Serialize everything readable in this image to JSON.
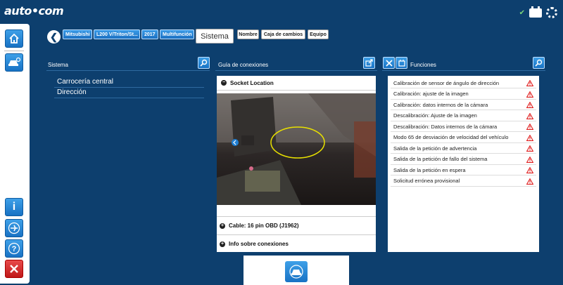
{
  "app": {
    "logo": "auto•com"
  },
  "breadcrumb": [
    "Mitsubishi",
    "L200 V/Triton/St...",
    "2017",
    "Multifunción"
  ],
  "tabs": {
    "active": "Sistema",
    "others": [
      "Nombre",
      "Caja de cambios",
      "Equipo"
    ]
  },
  "sistema": {
    "title": "Sistema",
    "items": [
      "Carrocería central",
      "Dirección"
    ]
  },
  "guia": {
    "title": "Guía de conexiones",
    "socket_label": "Socket Location",
    "cable_label": "Cable: 16 pin OBD (J1962)",
    "info_label": "Info sobre conexiones"
  },
  "funciones": {
    "title": "Funciones",
    "items": [
      "Calibración de sensor de ángulo de dirección",
      "Calibración: ajuste de la imagen",
      "Calibración: datos internos de la cámara",
      "Descalibración: Ajuste de la imagen",
      "Descalibración: Datos internos de la cámara",
      "Modo 65 de desviación de velocidad del vehículo",
      "Salida de la petición de advertencia",
      "Salida de la petición de fallo del sistema",
      "Salida de la petición en espera",
      "Solicitud errónea provisional"
    ]
  },
  "colors": {
    "background": "#0d3f6e",
    "accent": "#1f7fd4",
    "warning": "#e02020"
  }
}
